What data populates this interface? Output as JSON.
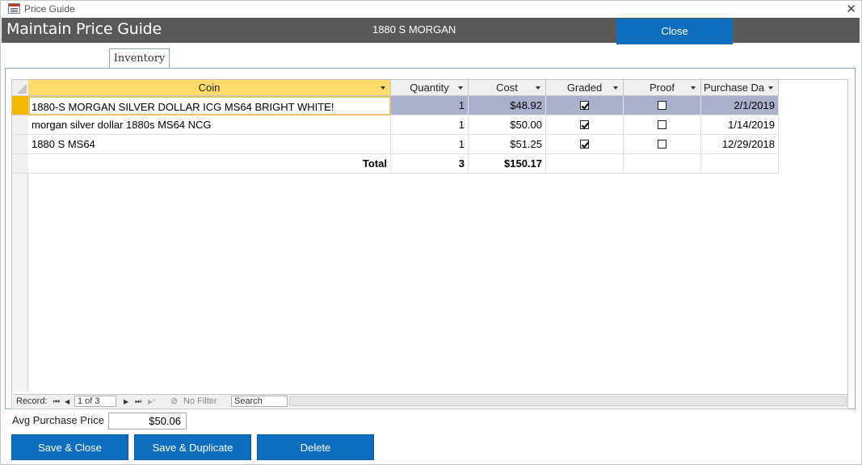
{
  "window": {
    "title": "Price Guide",
    "close_glyph": "✕"
  },
  "header": {
    "title": "Maintain Price Guide",
    "record": "1880 S MORGAN",
    "close_label": "Close"
  },
  "tab": {
    "label": "Inventory"
  },
  "grid": {
    "columns": [
      "Coin",
      "Quantity",
      "Cost",
      "Graded",
      "Proof",
      "Purchase Da"
    ],
    "rows": [
      {
        "coin": "1880-S MORGAN SILVER DOLLAR ICG MS64 BRIGHT WHITE!",
        "quantity": "1",
        "cost": "$48.92",
        "graded": true,
        "proof": false,
        "purchase_date": "2/1/2019"
      },
      {
        "coin": "morgan silver dollar 1880s MS64 NCG",
        "quantity": "1",
        "cost": "$50.00",
        "graded": true,
        "proof": false,
        "purchase_date": "1/14/2019"
      },
      {
        "coin": "1880 S MS64",
        "quantity": "1",
        "cost": "$51.25",
        "graded": true,
        "proof": false,
        "purchase_date": "12/29/2018"
      }
    ],
    "totals": {
      "label": "Total",
      "quantity": "3",
      "cost": "$150.17"
    }
  },
  "navigation": {
    "record_label": "Record:",
    "first_glyph": "⏮",
    "prev_glyph": "◀",
    "next_glyph": "▶",
    "last_glyph": "⏭",
    "new_glyph": "▶*",
    "position": "1 of 3",
    "filter_label": "No Filter",
    "search_placeholder": "Search"
  },
  "summary": {
    "avg_label": "Avg Purchase Price",
    "avg_value": "$50.06"
  },
  "buttons": {
    "save_close": "Save & Close",
    "save_duplicate": "Save & Duplicate",
    "delete": "Delete"
  },
  "colors": {
    "accent": "#0d6ebf",
    "header_bg": "#595959",
    "selection": "#a8b0cc",
    "active_header": "#fddc6c"
  }
}
